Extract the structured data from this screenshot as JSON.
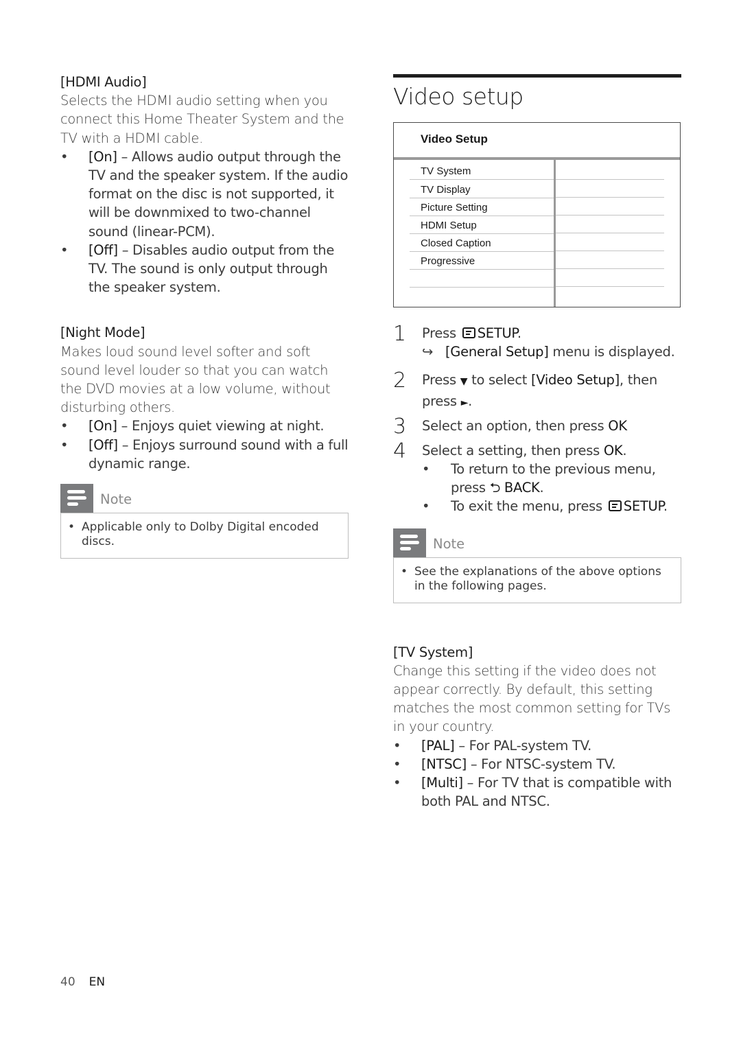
{
  "left": {
    "hdmi_audio": {
      "heading": "[HDMI Audio]",
      "description": "Selects the HDMI audio setting when you connect this Home Theater System and the TV with a HDMI cable.",
      "options": [
        {
          "label": "[On]",
          "text": " – Allows audio output through the TV and the speaker system. If the audio format on the disc is not supported, it will be downmixed to two-channel sound (linear-PCM)."
        },
        {
          "label": "[Off]",
          "text": " – Disables audio output from the TV. The sound is only output through the speaker system."
        }
      ]
    },
    "night_mode": {
      "heading": "[Night Mode]",
      "description": "Makes loud sound level softer and soft sound level louder so that you can watch the DVD movies at a low volume, without disturbing others.",
      "options": [
        {
          "label": "[On]",
          "text": " – Enjoys quiet viewing at night."
        },
        {
          "label": "[Off]",
          "text": " – Enjoys surround sound with a full dynamic range."
        }
      ]
    },
    "note": {
      "title": "Note",
      "icon": "note-icon",
      "items": [
        "Applicable only to Dolby Digital encoded discs."
      ]
    }
  },
  "right": {
    "section_title": "Video setup",
    "menu": {
      "title": "Video Setup",
      "items": [
        "TV System",
        "TV Display",
        "Picture Setting",
        "HDMI Setup",
        "Closed Caption",
        "Progressive"
      ]
    },
    "steps": [
      {
        "num": "1",
        "pre": "Press ",
        "icon": "setup-icon",
        "key": "SETUP",
        "post": ".",
        "result_arrow": "↪",
        "result_bold": "[General Setup]",
        "result_text": " menu is displayed."
      },
      {
        "num": "2",
        "pre": "Press ",
        "down_glyph": "▼",
        "mid": " to select ",
        "bold": "[Video Setup]",
        "post": ", then press ",
        "right_glyph": "►",
        "end": "."
      },
      {
        "num": "3",
        "pre": "Select an option, then press ",
        "bold": "OK",
        "post": ""
      },
      {
        "num": "4",
        "pre": "Select a setting, then press ",
        "bold": "OK",
        "post": ".",
        "subs": [
          {
            "pre": "To return to the previous menu, press ",
            "glyph": "⮌",
            "key": "BACK",
            "post": "."
          },
          {
            "pre": "To exit the menu, press ",
            "icon": "setup-icon",
            "key": "SETUP",
            "post": "."
          }
        ]
      }
    ],
    "note": {
      "title": "Note",
      "icon": "note-icon",
      "items": [
        "See the explanations of the above options in the following pages."
      ]
    },
    "tv_system": {
      "heading": "[TV System]",
      "description": "Change this setting if the video does not appear correctly. By default, this setting matches the most common setting for TVs in your country.",
      "options": [
        {
          "label": "[PAL]",
          "text": " – For PAL-system TV."
        },
        {
          "label": "[NTSC]",
          "text": " – For NTSC-system TV."
        },
        {
          "label": "[Multi]",
          "text": " – For TV that is compatible with both PAL and NTSC."
        }
      ]
    }
  },
  "footer": {
    "page_number": "40",
    "language": "EN"
  },
  "bullet_glyph": "•"
}
